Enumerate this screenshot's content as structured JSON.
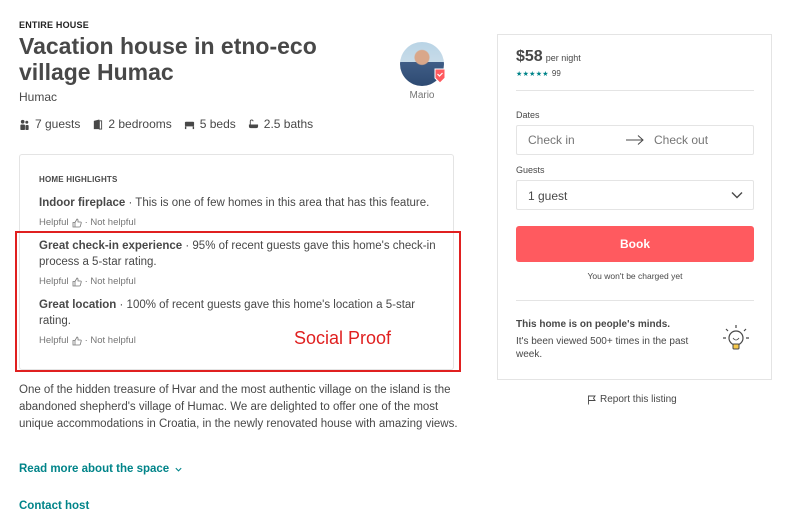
{
  "listing": {
    "property_type": "ENTIRE HOUSE",
    "title": "Vacation house in etno-eco village Humac",
    "location": "Humac",
    "host_name": "Mario",
    "stats": {
      "guests": "7 guests",
      "bedrooms": "2 bedrooms",
      "beds": "5 beds",
      "baths": "2.5 baths"
    }
  },
  "highlights": {
    "heading": "HOME HIGHLIGHTS",
    "items": [
      {
        "title": "Indoor fireplace",
        "text": " · This is one of few homes in this area that has this feature.",
        "helpful": "Helpful",
        "not_helpful": "· Not helpful"
      },
      {
        "title": "Great check-in experience",
        "text": " · 95% of recent guests gave this home's check-in process a 5-star rating.",
        "helpful": "Helpful",
        "not_helpful": "· Not helpful"
      },
      {
        "title": "Great location",
        "text": " · 100% of recent guests gave this home's location a 5-star rating.",
        "helpful": "Helpful",
        "not_helpful": "· Not helpful"
      }
    ]
  },
  "annotation": "Social Proof",
  "description": "One of the hidden treasure of Hvar and the most authentic village on the island is the abandoned shepherd's village of Humac. We are delighted to offer one of the most unique accommodations in Croatia, in the newly renovated house with amazing views.",
  "links": {
    "read_more": "Read more about the space",
    "contact_host": "Contact host",
    "report": "Report this listing"
  },
  "booking": {
    "price": "$58",
    "price_unit": "per night",
    "stars": "★★★★★",
    "review_count": "99",
    "dates_label": "Dates",
    "check_in": "Check in",
    "check_out": "Check out",
    "guests_label": "Guests",
    "guests_value": "1 guest",
    "book_label": "Book",
    "no_charge": "You won't be charged yet",
    "minds_title": "This home is on people's minds.",
    "minds_text": "It's been viewed 500+ times in the past week."
  },
  "colors": {
    "accent_teal": "#008489",
    "book_button": "#ff5a5f",
    "annotation_red": "#e02020"
  }
}
